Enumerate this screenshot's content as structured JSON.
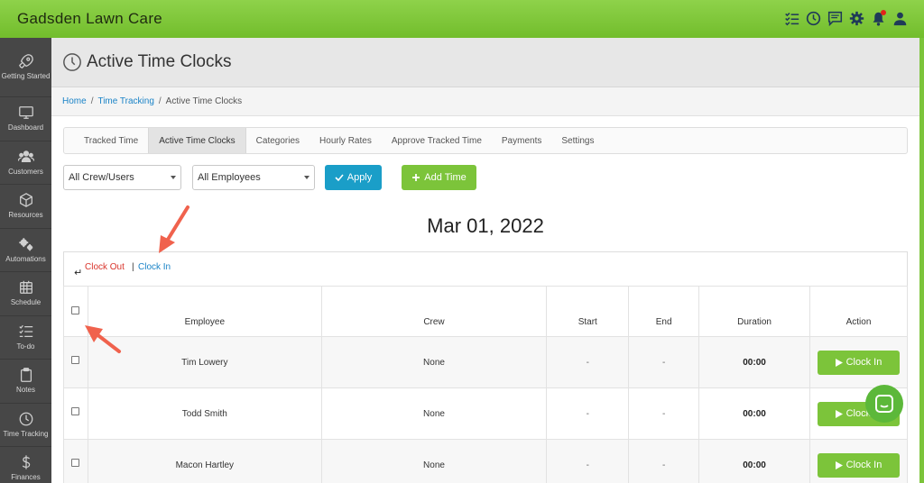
{
  "app": {
    "brand": "Gadsden Lawn Care"
  },
  "topbar_icons": [
    "checklist-icon",
    "clock-icon",
    "chat-icon",
    "gear-icon",
    "bell-icon",
    "user-icon"
  ],
  "sidebar": {
    "items": [
      {
        "label": "Getting Started",
        "icon": "rocket-icon"
      },
      {
        "label": "Dashboard",
        "icon": "monitor-icon"
      },
      {
        "label": "Customers",
        "icon": "users-icon"
      },
      {
        "label": "Resources",
        "icon": "box-icon"
      },
      {
        "label": "Automations",
        "icon": "gears-icon"
      },
      {
        "label": "Schedule",
        "icon": "calendar-icon"
      },
      {
        "label": "To-do",
        "icon": "todo-icon"
      },
      {
        "label": "Notes",
        "icon": "clipboard-icon"
      },
      {
        "label": "Time Tracking",
        "icon": "clock-icon"
      },
      {
        "label": "Finances",
        "icon": "dollar-icon"
      }
    ]
  },
  "header": {
    "title": "Active Time Clocks"
  },
  "breadcrumb": {
    "home": "Home",
    "section": "Time Tracking",
    "current": "Active Time Clocks"
  },
  "tabs": [
    {
      "label": "Tracked Time",
      "active": false
    },
    {
      "label": "Active Time Clocks",
      "active": true
    },
    {
      "label": "Categories",
      "active": false
    },
    {
      "label": "Hourly Rates",
      "active": false
    },
    {
      "label": "Approve Tracked Time",
      "active": false
    },
    {
      "label": "Payments",
      "active": false
    },
    {
      "label": "Settings",
      "active": false
    }
  ],
  "filters": {
    "crew_select": "All Crew/Users",
    "employee_select": "All Employees",
    "apply_label": "Apply",
    "add_time_label": "Add Time"
  },
  "date_heading": "Mar 01, 2022",
  "bulk_actions": {
    "clock_out": "Clock Out",
    "separator": "|",
    "clock_in": "Clock In"
  },
  "table": {
    "columns": [
      "Employee",
      "Crew",
      "Start",
      "End",
      "Duration",
      "Action"
    ],
    "rows": [
      {
        "employee": "Tim Lowery",
        "crew": "None",
        "start": "-",
        "end": "-",
        "duration": "00:00",
        "action": "Clock In"
      },
      {
        "employee": "Todd Smith",
        "crew": "None",
        "start": "-",
        "end": "-",
        "duration": "00:00",
        "action": "Clock In"
      },
      {
        "employee": "Macon Hartley",
        "crew": "None",
        "start": "-",
        "end": "-",
        "duration": "00:00",
        "action": "Clock In"
      }
    ]
  },
  "colors": {
    "brand_green": "#7cc43a",
    "apply_blue": "#1a9ec8",
    "sidebar_bg": "#474747",
    "clock_out_red": "#d9342b",
    "link_blue": "#1a83c7",
    "annotation_arrow": "#f0624d"
  }
}
